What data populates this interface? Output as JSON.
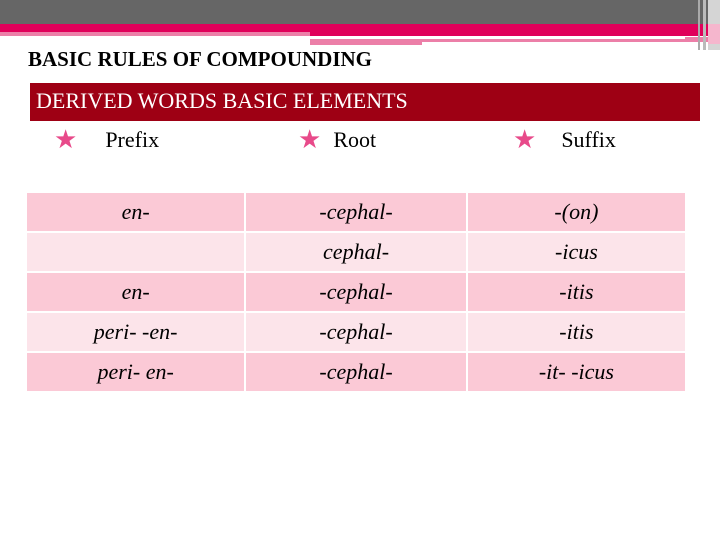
{
  "slide": {
    "title": "BASIC RULES OF COMPOUNDING",
    "banner": "DERIVED WORDS BASIC ELEMENTS",
    "colors": {
      "banner_bg": "#9e0014",
      "star": "#e84a8a",
      "row_dark": "#fbc9d6",
      "row_light": "#fce4ea",
      "stripe_magenta": "#e0005a",
      "stripe_gray": "#666666"
    },
    "columns": [
      {
        "icon": "star-icon",
        "label": "Prefix"
      },
      {
        "icon": "star-icon",
        "label": "Root"
      },
      {
        "icon": "star-icon",
        "label": "Suffix"
      }
    ],
    "rows": [
      {
        "prefix": "en-",
        "root": "-cephal-",
        "suffix": "-(on)"
      },
      {
        "prefix": "",
        "root": "cephal-",
        "suffix": "-icus"
      },
      {
        "prefix": "en-",
        "root": "-cephal-",
        "suffix": "-itis"
      },
      {
        "prefix": "peri- -en-",
        "root": "-cephal-",
        "suffix": "-itis"
      },
      {
        "prefix": "peri- en-",
        "root": "-cephal-",
        "suffix": "-it- -icus"
      }
    ]
  }
}
